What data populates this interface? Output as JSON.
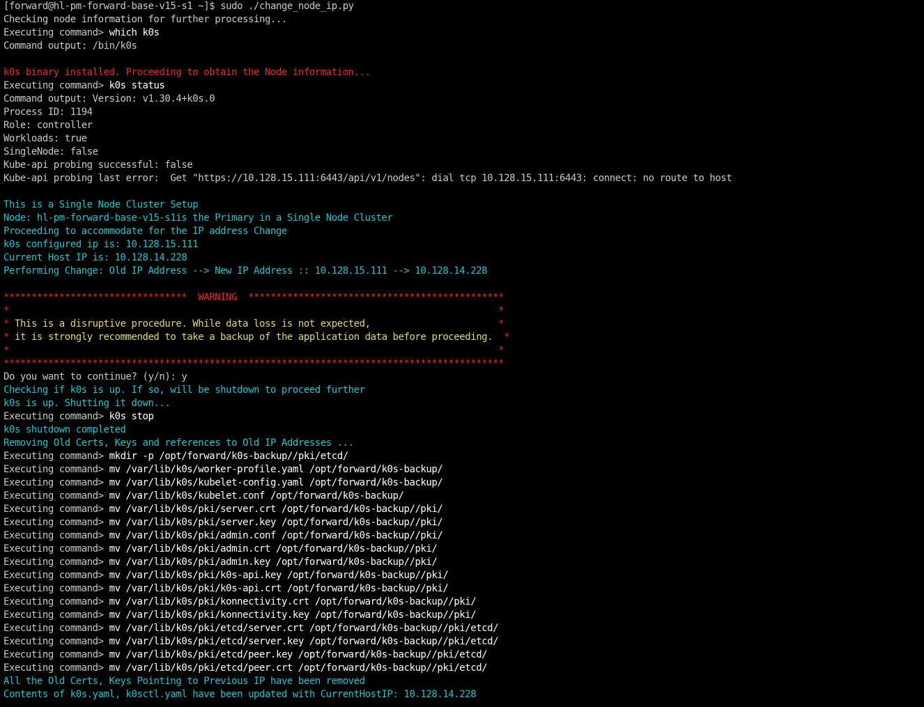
{
  "colors": {
    "background": "#000000",
    "default_text": "#c9c9c9",
    "command_text": "#ffffff",
    "error_red": "#ec2b2b",
    "info_cyan": "#1cc7d2",
    "warning_yellow": "#e3d96a"
  },
  "terminal": {
    "lines": [
      {
        "segments": [
          {
            "text": "[forward@hl-pm-forward-base-v15-s1 ~]$ sudo ./change_node_ip.py",
            "color": "gray"
          }
        ]
      },
      {
        "segments": [
          {
            "text": "Checking node information for further processing...",
            "color": "gray"
          }
        ]
      },
      {
        "segments": [
          {
            "text": "Executing command> ",
            "color": "gray"
          },
          {
            "text": "which k0s",
            "color": "white"
          }
        ]
      },
      {
        "segments": [
          {
            "text": "Command output: /bin/k0s",
            "color": "gray"
          }
        ]
      },
      {
        "segments": []
      },
      {
        "segments": [
          {
            "text": "k0s binary installed. Proceeding to obtain the Node information...",
            "color": "red"
          }
        ]
      },
      {
        "segments": [
          {
            "text": "Executing command> ",
            "color": "gray"
          },
          {
            "text": "k0s status",
            "color": "white"
          }
        ]
      },
      {
        "segments": [
          {
            "text": "Command output: Version: v1.30.4+k0s.0",
            "color": "gray"
          }
        ]
      },
      {
        "segments": [
          {
            "text": "Process ID: 1194",
            "color": "gray"
          }
        ]
      },
      {
        "segments": [
          {
            "text": "Role: controller",
            "color": "gray"
          }
        ]
      },
      {
        "segments": [
          {
            "text": "Workloads: true",
            "color": "gray"
          }
        ]
      },
      {
        "segments": [
          {
            "text": "SingleNode: false",
            "color": "gray"
          }
        ]
      },
      {
        "segments": [
          {
            "text": "Kube-api probing successful: false",
            "color": "gray"
          }
        ]
      },
      {
        "segments": [
          {
            "text": "Kube-api probing last error:  Get \"https://10.128.15.111:6443/api/v1/nodes\": dial tcp 10.128.15.111:6443: connect: no route to host",
            "color": "gray"
          }
        ]
      },
      {
        "segments": []
      },
      {
        "segments": [
          {
            "text": "This is a Single Node Cluster Setup",
            "color": "cyan"
          }
        ]
      },
      {
        "segments": [
          {
            "text": "Node: hl-pm-forward-base-v15-s1is the Primary in a Single Node Cluster",
            "color": "cyan"
          }
        ]
      },
      {
        "segments": [
          {
            "text": "Proceeding to accommodate for the IP address Change",
            "color": "cyan"
          }
        ]
      },
      {
        "segments": [
          {
            "text": "k0s configured ip is: 10.128.15.111",
            "color": "cyan"
          }
        ]
      },
      {
        "segments": [
          {
            "text": "Current Host IP is: 10.128.14.228",
            "color": "cyan"
          }
        ]
      },
      {
        "segments": [
          {
            "text": "Performing Change: Old IP Address --> New IP Address :: 10.128.15.111 --> 10.128.14.228",
            "color": "cyan"
          }
        ]
      },
      {
        "segments": []
      },
      {
        "segments": [
          {
            "text": "*********************************  WARNING  **********************************************",
            "color": "red"
          }
        ]
      },
      {
        "segments": [
          {
            "text": "*                                                                                        *",
            "color": "red"
          }
        ]
      },
      {
        "segments": [
          {
            "text": "* ",
            "color": "red"
          },
          {
            "text": "This is a disruptive procedure. While data loss is not expected,                       ",
            "color": "yellow"
          },
          {
            "text": "*",
            "color": "red"
          }
        ]
      },
      {
        "segments": [
          {
            "text": "* ",
            "color": "red"
          },
          {
            "text": "it is strongly recommended to take a backup of the application data before proceeding.  ",
            "color": "yellow"
          },
          {
            "text": "*",
            "color": "red"
          }
        ]
      },
      {
        "segments": [
          {
            "text": "*                                                                                        *",
            "color": "red"
          }
        ]
      },
      {
        "segments": [
          {
            "text": "******************************************************************************************",
            "color": "red"
          }
        ]
      },
      {
        "segments": [
          {
            "text": "Do you want to continue? (y/n): y",
            "color": "gray"
          }
        ]
      },
      {
        "segments": [
          {
            "text": "Checking if k0s is up. If so, will be shutdown to proceed further",
            "color": "cyan"
          }
        ]
      },
      {
        "segments": [
          {
            "text": "k0s is up. Shutting it down...",
            "color": "cyan"
          }
        ]
      },
      {
        "segments": [
          {
            "text": "Executing command> ",
            "color": "gray"
          },
          {
            "text": "k0s stop",
            "color": "white"
          }
        ]
      },
      {
        "segments": [
          {
            "text": "k0s shutdown completed",
            "color": "cyan"
          }
        ]
      },
      {
        "segments": [
          {
            "text": "Removing Old Certs, Keys and references to Old IP Addresses ...",
            "color": "cyan"
          }
        ]
      },
      {
        "segments": [
          {
            "text": "Executing command> ",
            "color": "gray"
          },
          {
            "text": "mkdir -p /opt/forward/k0s-backup//pki/etcd/",
            "color": "white"
          }
        ]
      },
      {
        "segments": [
          {
            "text": "Executing command> ",
            "color": "gray"
          },
          {
            "text": "mv /var/lib/k0s/worker-profile.yaml /opt/forward/k0s-backup/",
            "color": "white"
          }
        ]
      },
      {
        "segments": [
          {
            "text": "Executing command> ",
            "color": "gray"
          },
          {
            "text": "mv /var/lib/k0s/kubelet-config.yaml /opt/forward/k0s-backup/",
            "color": "white"
          }
        ]
      },
      {
        "segments": [
          {
            "text": "Executing command> ",
            "color": "gray"
          },
          {
            "text": "mv /var/lib/k0s/kubelet.conf /opt/forward/k0s-backup/",
            "color": "white"
          }
        ]
      },
      {
        "segments": [
          {
            "text": "Executing command> ",
            "color": "gray"
          },
          {
            "text": "mv /var/lib/k0s/pki/server.crt /opt/forward/k0s-backup//pki/",
            "color": "white"
          }
        ]
      },
      {
        "segments": [
          {
            "text": "Executing command> ",
            "color": "gray"
          },
          {
            "text": "mv /var/lib/k0s/pki/server.key /opt/forward/k0s-backup//pki/",
            "color": "white"
          }
        ]
      },
      {
        "segments": [
          {
            "text": "Executing command> ",
            "color": "gray"
          },
          {
            "text": "mv /var/lib/k0s/pki/admin.conf /opt/forward/k0s-backup//pki/",
            "color": "white"
          }
        ]
      },
      {
        "segments": [
          {
            "text": "Executing command> ",
            "color": "gray"
          },
          {
            "text": "mv /var/lib/k0s/pki/admin.crt /opt/forward/k0s-backup//pki/",
            "color": "white"
          }
        ]
      },
      {
        "segments": [
          {
            "text": "Executing command> ",
            "color": "gray"
          },
          {
            "text": "mv /var/lib/k0s/pki/admin.key /opt/forward/k0s-backup//pki/",
            "color": "white"
          }
        ]
      },
      {
        "segments": [
          {
            "text": "Executing command> ",
            "color": "gray"
          },
          {
            "text": "mv /var/lib/k0s/pki/k0s-api.key /opt/forward/k0s-backup//pki/",
            "color": "white"
          }
        ]
      },
      {
        "segments": [
          {
            "text": "Executing command> ",
            "color": "gray"
          },
          {
            "text": "mv /var/lib/k0s/pki/k0s-api.crt /opt/forward/k0s-backup//pki/",
            "color": "white"
          }
        ]
      },
      {
        "segments": [
          {
            "text": "Executing command> ",
            "color": "gray"
          },
          {
            "text": "mv /var/lib/k0s/pki/konnectivity.crt /opt/forward/k0s-backup//pki/",
            "color": "white"
          }
        ]
      },
      {
        "segments": [
          {
            "text": "Executing command> ",
            "color": "gray"
          },
          {
            "text": "mv /var/lib/k0s/pki/konnectivity.key /opt/forward/k0s-backup//pki/",
            "color": "white"
          }
        ]
      },
      {
        "segments": [
          {
            "text": "Executing command> ",
            "color": "gray"
          },
          {
            "text": "mv /var/lib/k0s/pki/etcd/server.crt /opt/forward/k0s-backup//pki/etcd/",
            "color": "white"
          }
        ]
      },
      {
        "segments": [
          {
            "text": "Executing command> ",
            "color": "gray"
          },
          {
            "text": "mv /var/lib/k0s/pki/etcd/server.key /opt/forward/k0s-backup//pki/etcd/",
            "color": "white"
          }
        ]
      },
      {
        "segments": [
          {
            "text": "Executing command> ",
            "color": "gray"
          },
          {
            "text": "mv /var/lib/k0s/pki/etcd/peer.key /opt/forward/k0s-backup//pki/etcd/",
            "color": "white"
          }
        ]
      },
      {
        "segments": [
          {
            "text": "Executing command> ",
            "color": "gray"
          },
          {
            "text": "mv /var/lib/k0s/pki/etcd/peer.crt /opt/forward/k0s-backup//pki/etcd/",
            "color": "white"
          }
        ]
      },
      {
        "segments": [
          {
            "text": "All the Old Certs, Keys Pointing to Previous IP have been removed",
            "color": "cyan"
          }
        ]
      },
      {
        "segments": [
          {
            "text": "Contents of k0s.yaml, k0sctl.yaml have been updated with CurrentHostIP: 10.128.14.228",
            "color": "cyan"
          }
        ]
      }
    ]
  }
}
